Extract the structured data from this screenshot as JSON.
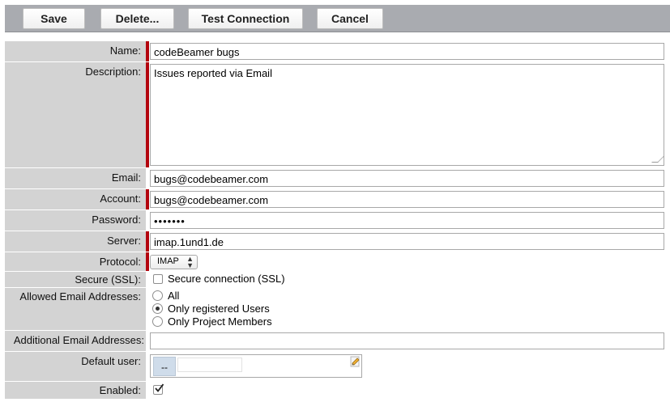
{
  "toolbar": {
    "save_label": "Save",
    "delete_label": "Delete...",
    "test_label": "Test Connection",
    "cancel_label": "Cancel"
  },
  "form": {
    "name": {
      "label": "Name:",
      "value": "codeBeamer bugs"
    },
    "description": {
      "label": "Description:",
      "value": "Issues reported via Email"
    },
    "email": {
      "label": "Email:",
      "value": "bugs@codebeamer.com"
    },
    "account": {
      "label": "Account:",
      "value": "bugs@codebeamer.com"
    },
    "password": {
      "label": "Password:",
      "value": "•••••••"
    },
    "server": {
      "label": "Server:",
      "value": "imap.1und1.de"
    },
    "protocol": {
      "label": "Protocol:",
      "value": "IMAP"
    },
    "secure": {
      "label": "Secure (SSL):",
      "option": "Secure connection (SSL)",
      "checked": false
    },
    "allowed": {
      "label": "Allowed Email Addresses:",
      "options": [
        "All",
        "Only registered Users",
        "Only Project Members"
      ],
      "selected": "Only registered Users"
    },
    "additional": {
      "label": "Additional Email Addresses:",
      "value": ""
    },
    "default_user": {
      "label": "Default user:",
      "chip": "--",
      "value": ""
    },
    "enabled": {
      "label": "Enabled:",
      "checked": true
    }
  },
  "colors": {
    "required_marker": "#b3040e",
    "label_bg": "#d3d3d3",
    "toolbar_bg": "#a9abb0"
  },
  "icons": {
    "edit": "pencil-icon",
    "check": "checkmark-icon"
  }
}
